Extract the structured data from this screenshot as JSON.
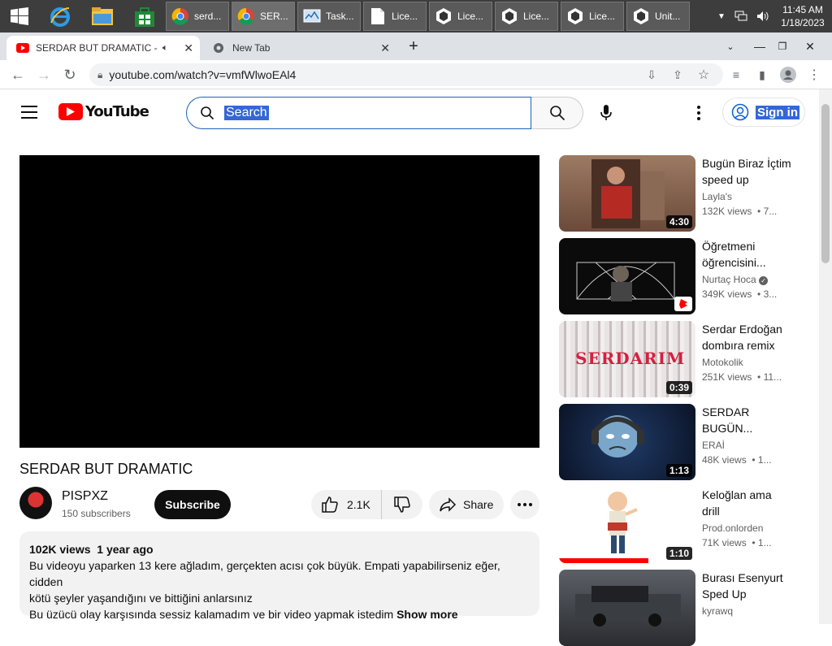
{
  "taskbar": {
    "tasks": [
      {
        "label": "serd..."
      },
      {
        "label": "SER..."
      },
      {
        "label": "Task..."
      },
      {
        "label": "Lice..."
      },
      {
        "label": "Lice..."
      },
      {
        "label": "Lice..."
      },
      {
        "label": "Lice..."
      },
      {
        "label": "Unit..."
      }
    ],
    "clock_time": "11:45 AM",
    "clock_date": "1/18/2023"
  },
  "browser": {
    "tabs": [
      {
        "title": "SERDAR BUT DRAMATIC - Yo"
      },
      {
        "title": "New Tab"
      }
    ],
    "url": "youtube.com/watch?v=vmfWlwoEAl4"
  },
  "youtube": {
    "logo_text": "YouTube",
    "search_value": "Search",
    "signin_label": "Sign in"
  },
  "video": {
    "title": "SERDAR BUT DRAMATIC",
    "channel": "PISPXZ",
    "subscribers": "150 subscribers",
    "subscribe_label": "Subscribe",
    "likes": "2.1K",
    "share_label": "Share",
    "views": "102K views",
    "age": "1 year ago",
    "desc_line1": "Bu videoyu yaparken 13 kere ağladım, gerçekten acısı çok büyük. Empati yapabilirseniz eğer, cidden",
    "desc_line2": "kötü şeyler yaşandığını ve bittiğini anlarsınız",
    "desc_line3": "Bu üzücü olay karşısında sessiz kalamadım ve bir video yapmak istedim",
    "show_more": "Show more"
  },
  "recommendations": [
    {
      "title": "Bugün Biraz İçtim speed up",
      "channel": "Layla's",
      "views": "132K views",
      "meta": "• 7...",
      "duration": "4:30"
    },
    {
      "title": "Öğretmeni öğrencisini...",
      "channel": "Nurtaç Hoca",
      "views": "349K views",
      "meta": "• 3...",
      "duration": ""
    },
    {
      "title": "Serdar Erdoğan dombıra remix",
      "channel": "Motokolik",
      "views": "251K views",
      "meta": "• 11...",
      "duration": "0:39",
      "thumb_text": "SERDARIM"
    },
    {
      "title": "SERDAR BUGÜN...",
      "channel": "ERAİ",
      "views": "48K views",
      "meta": "• 1...",
      "duration": "1:13"
    },
    {
      "title": "Keloğlan ama drill",
      "channel": "Prod.onlorden",
      "views": "71K views",
      "meta": "• 1...",
      "duration": "1:10"
    },
    {
      "title": "Burası Esenyurt Sped Up",
      "channel": "kyrawq",
      "views": "",
      "meta": "",
      "duration": ""
    }
  ]
}
